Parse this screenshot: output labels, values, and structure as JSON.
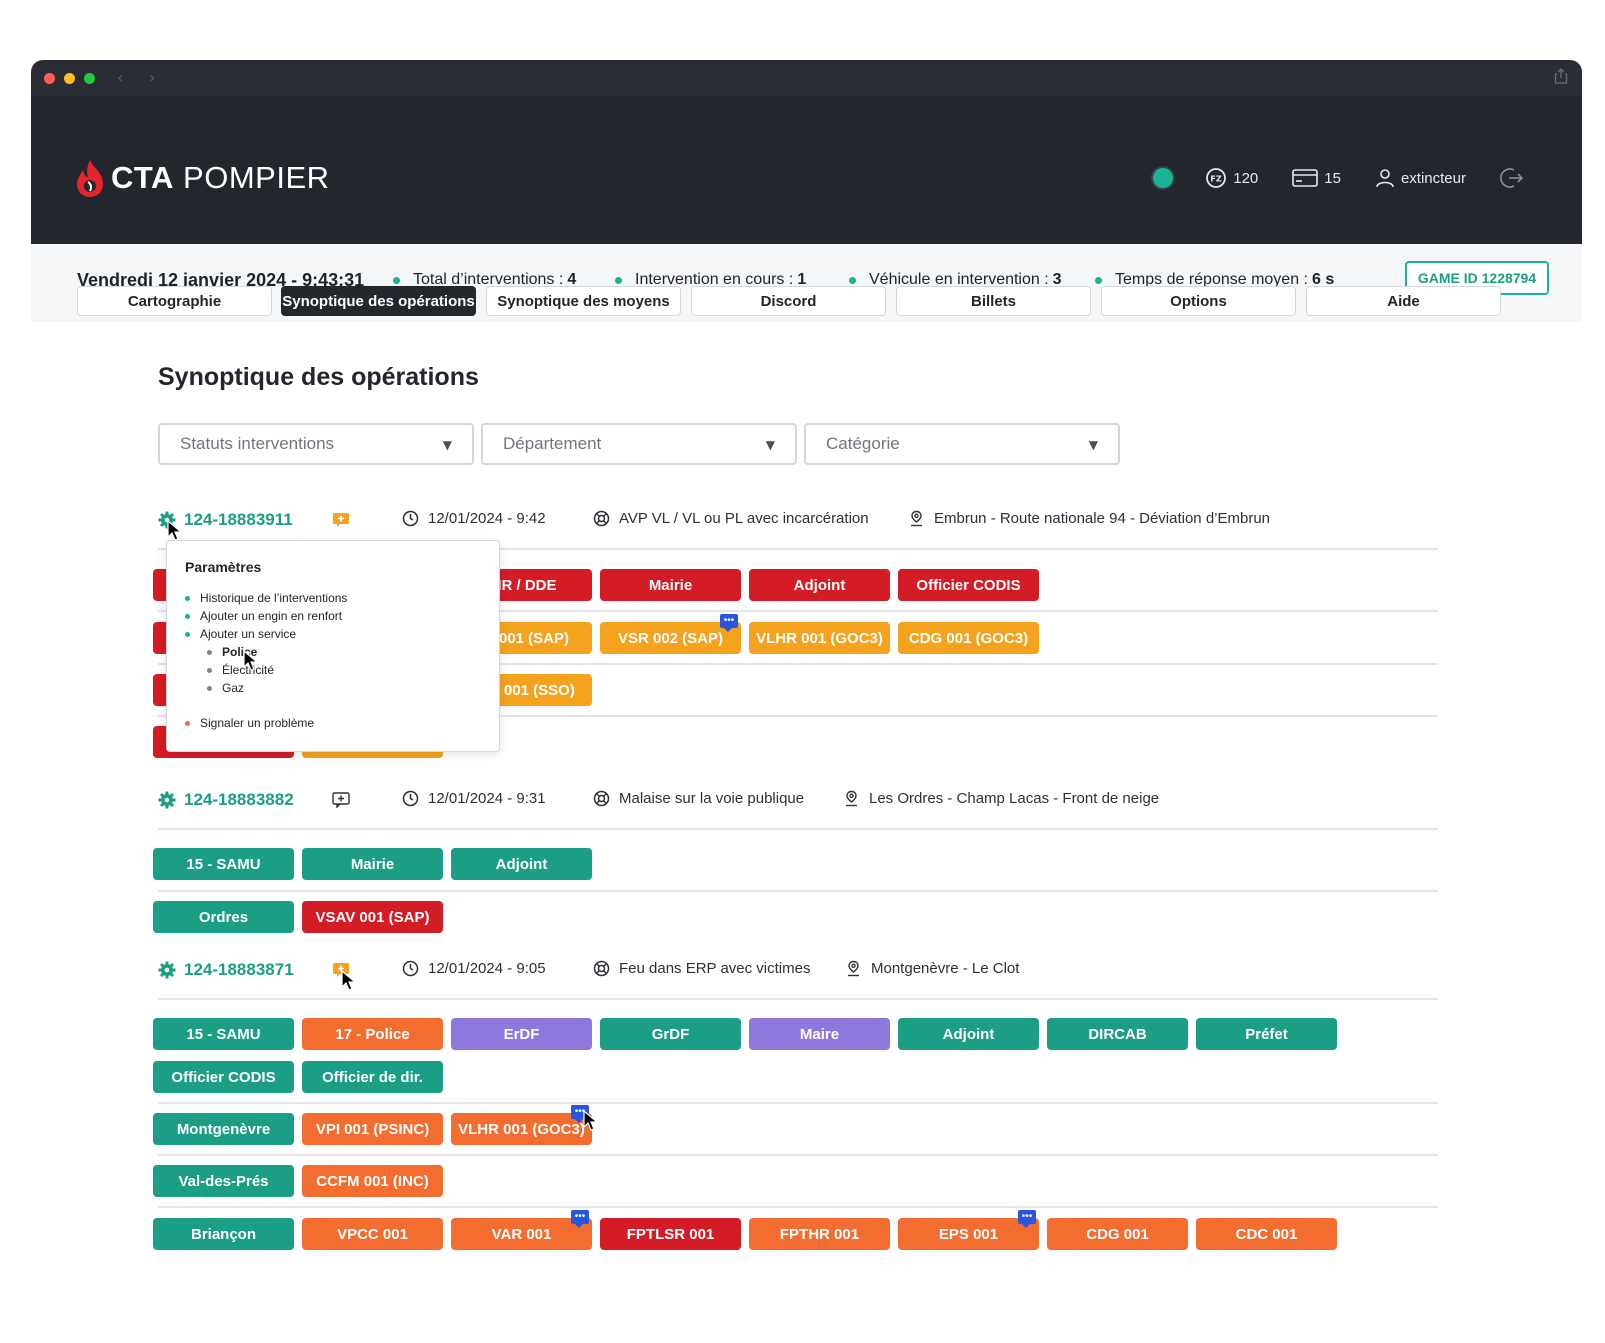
{
  "app": {
    "brand_bold": "CTA",
    "brand_regular": "POMPIER",
    "status_color": "#1bb295",
    "points": "120",
    "cards": "15",
    "username": "extincteur"
  },
  "stats": {
    "date": "Vendredi 12 janvier 2024 - 9:43:31",
    "total_label": "Total d’interventions :",
    "total_value": "4",
    "current_label": "Intervention en cours :",
    "current_value": "1",
    "vehicle_label": "Véhicule en intervention :",
    "vehicle_value": "3",
    "response_label": "Temps de réponse moyen :",
    "response_value": "6 s",
    "game_id": "GAME ID 1228794"
  },
  "tabs": [
    "Cartographie",
    "Synoptique des opérations",
    "Synoptique des moyens",
    "Discord",
    "Billets",
    "Options",
    "Aide"
  ],
  "page_title": "Synoptique des opérations",
  "filters": [
    "Statuts interventions",
    "Département",
    "Catégorie"
  ],
  "operations": [
    {
      "id": "124-18883911",
      "datetime": "12/01/2024 - 9:42",
      "type": "AVP VL / VL ou PL avec incarcération",
      "location": "Embrun - Route nationale 94 - Déviation d’Embrun",
      "rows": [
        [
          "DIR / DDE",
          "Mairie",
          "Adjoint",
          "Officier CODIS"
        ],
        [
          "SR 001 (SAP)",
          "VSR 002 (SAP)",
          "VLHR 001 (GOC3)",
          "CDG 001 (GOC3)"
        ],
        [
          "SSO 001 (SSO)"
        ]
      ]
    },
    {
      "id": "124-18883882",
      "datetime": "12/01/2024 - 9:31",
      "type": "Malaise sur la voie publique",
      "location": "Les Ordres - Champ Lacas - Front de neige",
      "rows": [
        [
          "15 - SAMU",
          "Mairie",
          "Adjoint"
        ],
        [
          "Ordres",
          "VSAV 001 (SAP)"
        ]
      ]
    },
    {
      "id": "124-18883871",
      "datetime": "12/01/2024 - 9:05",
      "type": "Feu dans ERP avec victimes",
      "location": "Montgenèvre - Le Clot",
      "rows": [
        [
          "15 - SAMU",
          "17 - Police",
          "ErDF",
          "GrDF",
          "Maire",
          "Adjoint",
          "DIRCAB",
          "Préfet"
        ],
        [
          "Officier CODIS",
          "Officier de dir."
        ],
        [
          "Montgenèvre",
          "VPI 001 (PSINC)",
          "VLHR 001 (GOC3)"
        ],
        [
          "Val-des-Prés",
          "CCFM 001 (INC)"
        ],
        [
          "Briançon",
          "VPCC 001",
          "VAR 001",
          "FPTLSR 001",
          "FPTHR 001",
          "EPS 001",
          "CDG 001",
          "CDC 001"
        ]
      ]
    }
  ],
  "popup": {
    "title": "Paramètres",
    "items": [
      "Historique de l’interventions",
      "Ajouter un engin en renfort",
      "Ajouter un service"
    ],
    "sub_items": [
      "Police",
      "Électricité",
      "Gaz"
    ],
    "report": "Signaler un problème"
  },
  "colors": {
    "teal": "#1b9e84",
    "red": "#d41c26",
    "orange": "#f5a21e",
    "orange_dark": "#f36c30",
    "purple": "#8f77e0",
    "message_badge": "#2757e0"
  }
}
